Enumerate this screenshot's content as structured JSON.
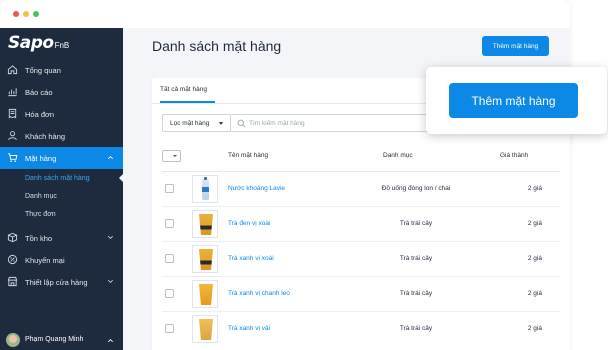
{
  "window": {
    "controls": [
      "close",
      "minimize",
      "zoom"
    ]
  },
  "logo": {
    "main": "Sapo",
    "sub": "FnB"
  },
  "sidebar": {
    "items": [
      {
        "label": "Tổng quan",
        "icon": "home-icon"
      },
      {
        "label": "Báo cáo",
        "icon": "chart-icon"
      },
      {
        "label": "Hóa đơn",
        "icon": "receipt-icon"
      },
      {
        "label": "Khách hàng",
        "icon": "user-icon"
      },
      {
        "label": "Mặt hàng",
        "icon": "cart-icon",
        "active": true,
        "expanded": true
      },
      {
        "label": "Tồn kho",
        "icon": "box-icon"
      },
      {
        "label": "Khuyến mại",
        "icon": "discount-icon"
      },
      {
        "label": "Thiết lập cửa hàng",
        "icon": "store-settings-icon"
      }
    ],
    "subitems": [
      {
        "label": "Danh sách mặt hàng",
        "active": true
      },
      {
        "label": "Danh mục"
      },
      {
        "label": "Thực đơn"
      }
    ],
    "user": {
      "name": "Phạm Quang Minh"
    }
  },
  "page": {
    "title": "Danh sách mặt hàng",
    "add_button": "Thêm mặt hàng"
  },
  "tabs": [
    {
      "label": "Tất cả mặt hàng",
      "active": true
    }
  ],
  "filter": {
    "label": "Lọc mặt hàng"
  },
  "search": {
    "placeholder": "Tìm kiếm mặt hàng"
  },
  "table": {
    "columns": {
      "name": "Tên mặt hàng",
      "category": "Danh mục",
      "price": "Giá thành"
    },
    "rows": [
      {
        "name": "Nước khoáng Lavie",
        "category": "Đồ uống đóng lon / chai",
        "price": "2 giá",
        "thumb": "bottle"
      },
      {
        "name": "Trà đen vị xoài",
        "category": "Trà trái cây",
        "price": "2 giá",
        "thumb": "cup-dark"
      },
      {
        "name": "Trà xanh vị xoài",
        "category": "Trà trái cây",
        "price": "2 giá",
        "thumb": "cup-dark"
      },
      {
        "name": "Trà xanh vị chanh leo",
        "category": "Trà trái cây",
        "price": "2 giá",
        "thumb": "cup-orange"
      },
      {
        "name": "Trà xanh vị vải",
        "category": "Trà trái cây",
        "price": "2 giá",
        "thumb": "cup-lychee"
      }
    ]
  },
  "callout": {
    "label": "Thêm mặt hàng"
  },
  "colors": {
    "accent": "#0c88e6",
    "sidebar": "#1e2a3d",
    "background": "#f3f5f8"
  }
}
